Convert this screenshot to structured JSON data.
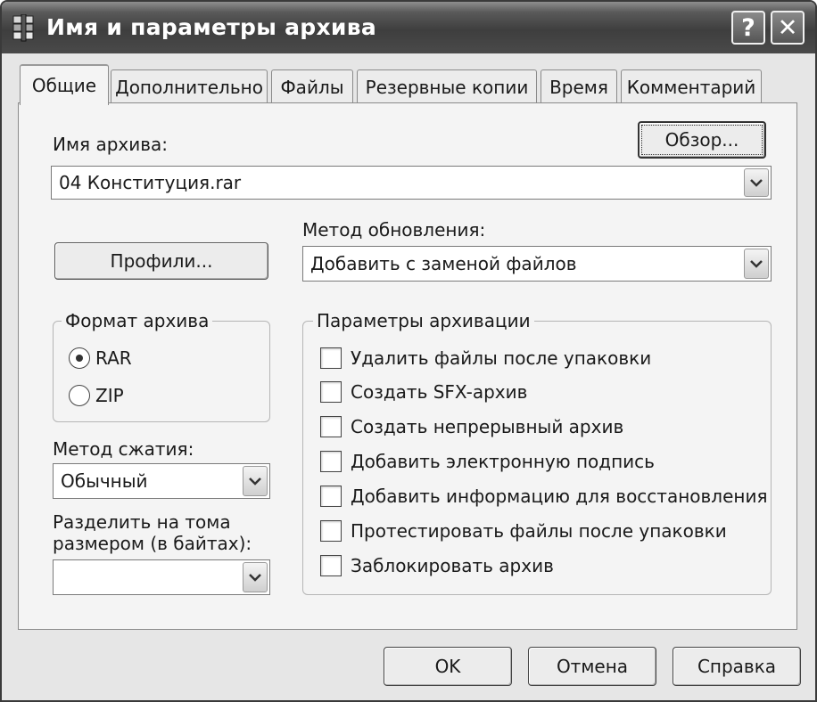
{
  "window": {
    "title": "Имя и параметры архива",
    "help_glyph": "?",
    "close_glyph": "✕"
  },
  "tabs": [
    {
      "label": "Общие",
      "active": true
    },
    {
      "label": "Дополнительно"
    },
    {
      "label": "Файлы"
    },
    {
      "label": "Резервные копии"
    },
    {
      "label": "Время"
    },
    {
      "label": "Комментарий"
    }
  ],
  "general": {
    "archive_name_label": "Имя архива:",
    "browse_label": "Обзор...",
    "archive_name_value": "04 Конституция.rar",
    "profiles_label": "Профили...",
    "update_method_label": "Метод обновления:",
    "update_method_value": "Добавить с заменой файлов",
    "format_group": {
      "label": "Формат архива",
      "options": [
        {
          "label": "RAR",
          "checked": true
        },
        {
          "label": "ZIP",
          "checked": false
        }
      ]
    },
    "compression_label": "Метод сжатия:",
    "compression_value": "Обычный",
    "split_label_line1": "Разделить на тома",
    "split_label_line2": "размером (в байтах):",
    "split_value": "",
    "options_group": {
      "label": "Параметры архивации",
      "items": [
        {
          "label": "Удалить файлы после упаковки",
          "checked": false
        },
        {
          "label": "Создать SFX-архив",
          "checked": false
        },
        {
          "label": "Создать непрерывный архив",
          "checked": false
        },
        {
          "label": "Добавить электронную подпись",
          "checked": false
        },
        {
          "label": "Добавить информацию для восстановления",
          "checked": false
        },
        {
          "label": "Протестировать файлы после упаковки",
          "checked": false
        },
        {
          "label": "Заблокировать архив",
          "checked": false
        }
      ]
    }
  },
  "footer": {
    "ok_label": "OK",
    "cancel_label": "Отмена",
    "help_label": "Справка"
  }
}
